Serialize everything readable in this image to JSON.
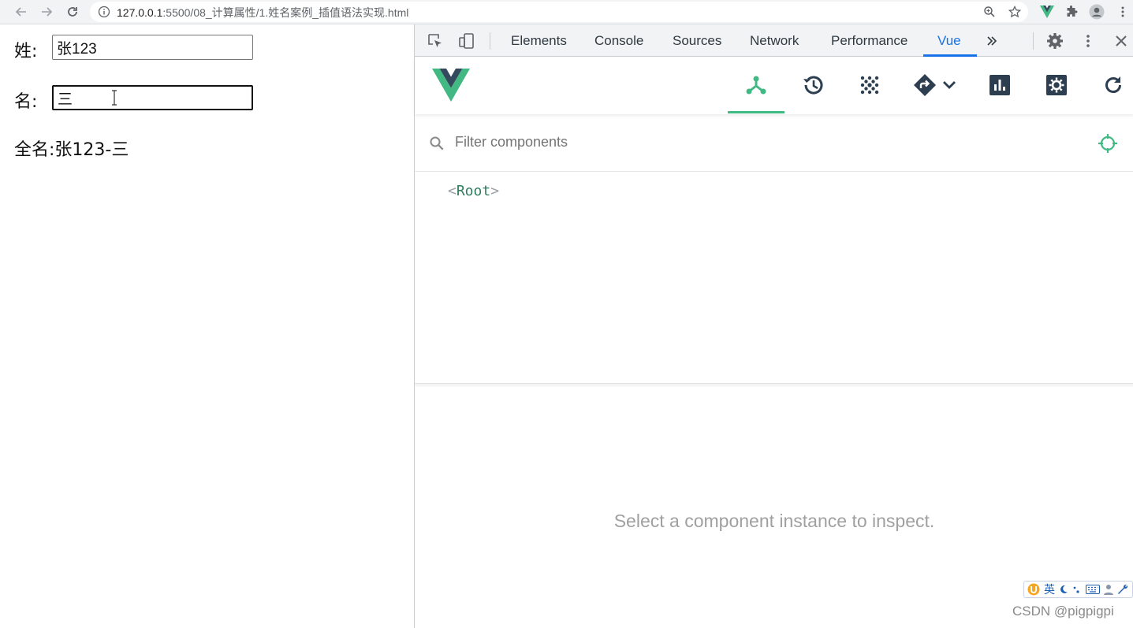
{
  "browser": {
    "url_host": "127.0.0.1",
    "url_path": ":5500/08_计算属性/1.姓名案例_插值语法实现.html"
  },
  "page": {
    "last_name_label": "姓:",
    "last_name_value": "张123",
    "first_name_label": "名:",
    "first_name_value": "三",
    "full_name_label": "全名:",
    "full_name_value": "张123-三"
  },
  "devtools": {
    "tabs": [
      "Elements",
      "Console",
      "Sources",
      "Network",
      "Performance",
      "Vue"
    ],
    "active_tab": "Vue"
  },
  "vue": {
    "filter_placeholder": "Filter components",
    "root_name": "Root",
    "empty_message": "Select a component instance to inspect."
  },
  "ime": {
    "mode": "英"
  },
  "watermark": "CSDN @pigpigpi",
  "colors": {
    "vue_green": "#42b883",
    "vue_dark": "#35495e",
    "devtools_blue": "#1a73e8"
  }
}
